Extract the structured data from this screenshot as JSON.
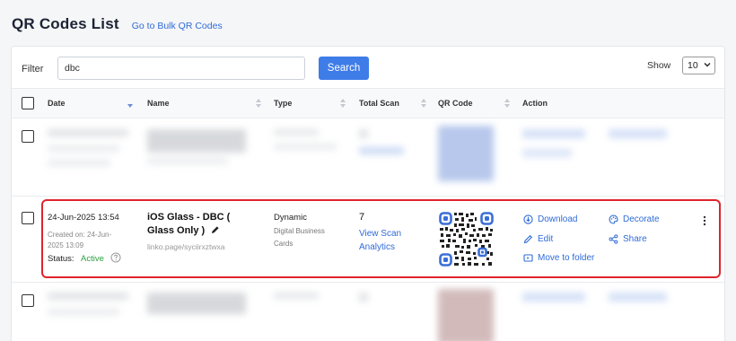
{
  "header": {
    "title": "QR Codes List",
    "bulk_link": "Go to Bulk QR Codes"
  },
  "filter": {
    "label": "Filter",
    "value": "dbc",
    "search_label": "Search",
    "show_label": "Show",
    "show_value": "10"
  },
  "columns": [
    "Date",
    "Name",
    "Type",
    "Total Scan",
    "QR Code",
    "Action"
  ],
  "row": {
    "date": "24-Jun-2025 13:54",
    "created_line1": "Created on: 24-Jun-",
    "created_line2": "2025 13:09",
    "status_label": "Status:",
    "status_value": "Active",
    "name_line1": "iOS Glass - DBC (",
    "name_line2": "Glass Only )",
    "url": "linko.page/syciirxztwxa",
    "type_line1": "Dynamic",
    "type_line2": "Digital Business",
    "type_line3": "Cards",
    "scans": "7",
    "analytics_line1": "View Scan",
    "analytics_line2": "Analytics",
    "actions": {
      "download": "Download",
      "decorate": "Decorate",
      "edit": "Edit",
      "share": "Share",
      "move": "Move to folder"
    }
  },
  "colors": {
    "accent": "#3e7ce8",
    "link": "#2f6bd8",
    "active": "#2e9e3e",
    "highlight": "#e0242c"
  }
}
